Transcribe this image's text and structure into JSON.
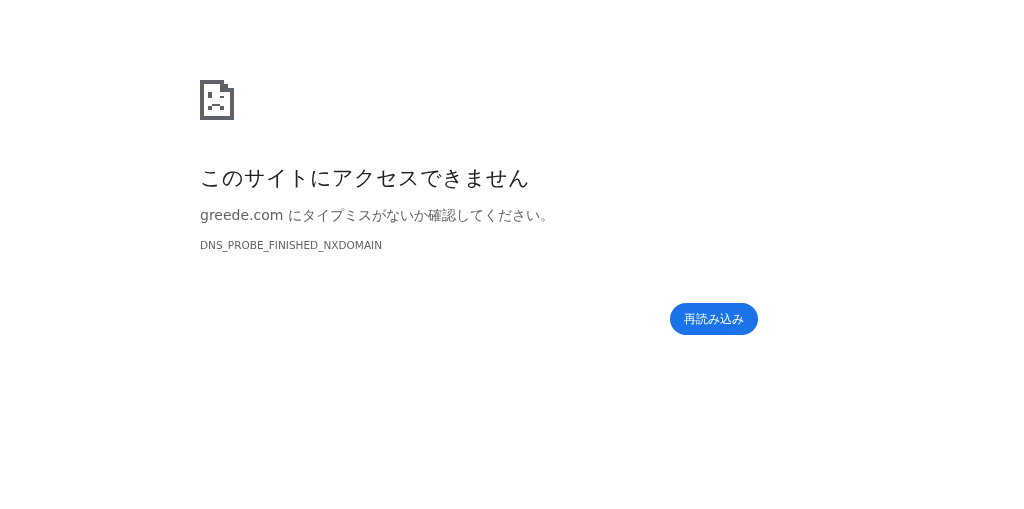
{
  "heading": "このサイトにアクセスできません",
  "message": "greede.com にタイプミスがないか確認してください。",
  "error_code": "DNS_PROBE_FINISHED_NXDOMAIN",
  "buttons": [
    {
      "label": "再読み込み"
    }
  ]
}
